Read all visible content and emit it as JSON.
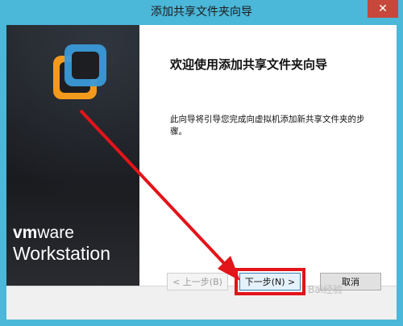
{
  "window": {
    "title": "添加共享文件夹向导",
    "close_glyph": "✕"
  },
  "banner": {
    "brand_vm": "vm",
    "brand_ware": "ware",
    "brand_product": "Workstation",
    "logo_icon": "vmware-logo"
  },
  "content": {
    "heading": "欢迎使用添加共享文件夹向导",
    "description": "此向导将引导您完成向虚拟机添加新共享文件夹的步骤。"
  },
  "buttons": {
    "back": "< 上一步(B)",
    "next": "下一步(N) >",
    "cancel": "取消"
  },
  "annotations": {
    "arrow_color": "#e3141a",
    "highlight_color": "#e3141a",
    "watermark": "Bai经验"
  }
}
